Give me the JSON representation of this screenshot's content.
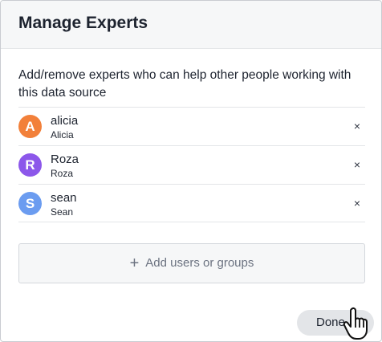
{
  "dialog": {
    "title": "Manage Experts",
    "description": "Add/remove experts who can help other people working with this data source"
  },
  "experts": [
    {
      "initial": "A",
      "name": "alicia",
      "display_name": "Alicia",
      "color": "#f2803a"
    },
    {
      "initial": "R",
      "name": "Roza",
      "display_name": "Roza",
      "color": "#8c57ea"
    },
    {
      "initial": "S",
      "name": "sean",
      "display_name": "Sean",
      "color": "#6b9cf0"
    }
  ],
  "remove_icon": "×",
  "add_button": {
    "icon": "+",
    "label": "Add users or groups"
  },
  "done_button": {
    "label": "Done"
  },
  "icons": {
    "remove": "close-icon",
    "add": "plus-icon",
    "cursor": "hand-pointer-cursor"
  }
}
